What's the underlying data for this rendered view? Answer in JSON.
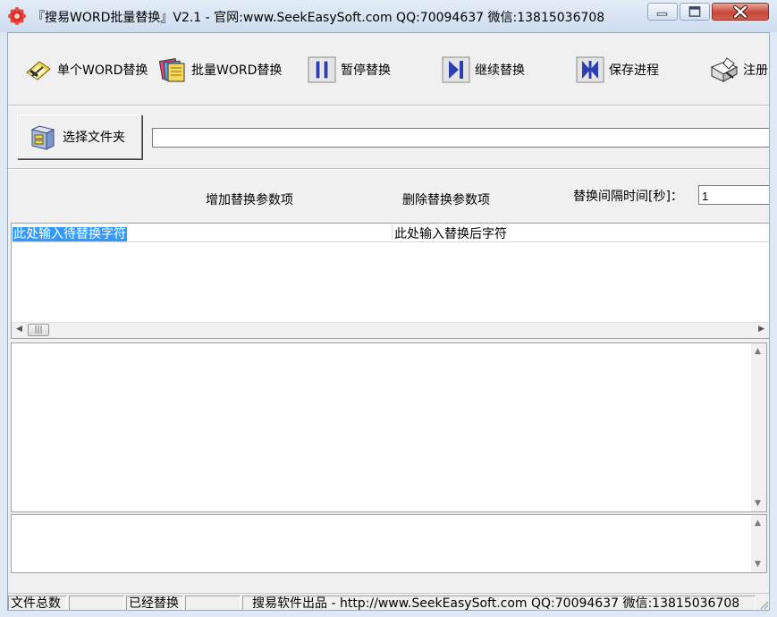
{
  "window": {
    "title": "『搜易WORD批量替换』V2.1    -   官网:www.SeekEasySoft.com  QQ:70094637  微信:13815036708",
    "app_icon": "red-gear-icon",
    "caption_buttons": [
      "minimize-icon",
      "maximize-icon",
      "close-icon"
    ]
  },
  "toolbar": {
    "items": [
      {
        "label": "单个WORD替换",
        "icon": "single-document-icon"
      },
      {
        "label": "批量WORD替换",
        "icon": "multiple-documents-icon"
      },
      {
        "label": "暂停替换",
        "icon": "pause-icon"
      },
      {
        "label": "继续替换",
        "icon": "play-next-icon"
      },
      {
        "label": "保存进程",
        "icon": "save-progress-icon"
      },
      {
        "label": "注册",
        "icon": "register-icon"
      }
    ]
  },
  "folder": {
    "button_label": "选择文件夹",
    "icon": "folder-cabinet-icon",
    "path_value": ""
  },
  "params": {
    "add_label": "增加替换参数项",
    "delete_label": "删除替换参数项",
    "interval_label": "替换间隔时间[秒]：",
    "interval_value": "1"
  },
  "grid": {
    "rows": [
      {
        "find": "此处输入待替换字符",
        "replace": "此处输入替换后字符"
      }
    ]
  },
  "statusbar": {
    "total_label": "文件总数",
    "total_value": "",
    "done_label": "已经替换",
    "done_value": "",
    "credit": "搜易软件出品 - http://www.SeekEasySoft.com  QQ:70094637  微信:13815036708"
  }
}
